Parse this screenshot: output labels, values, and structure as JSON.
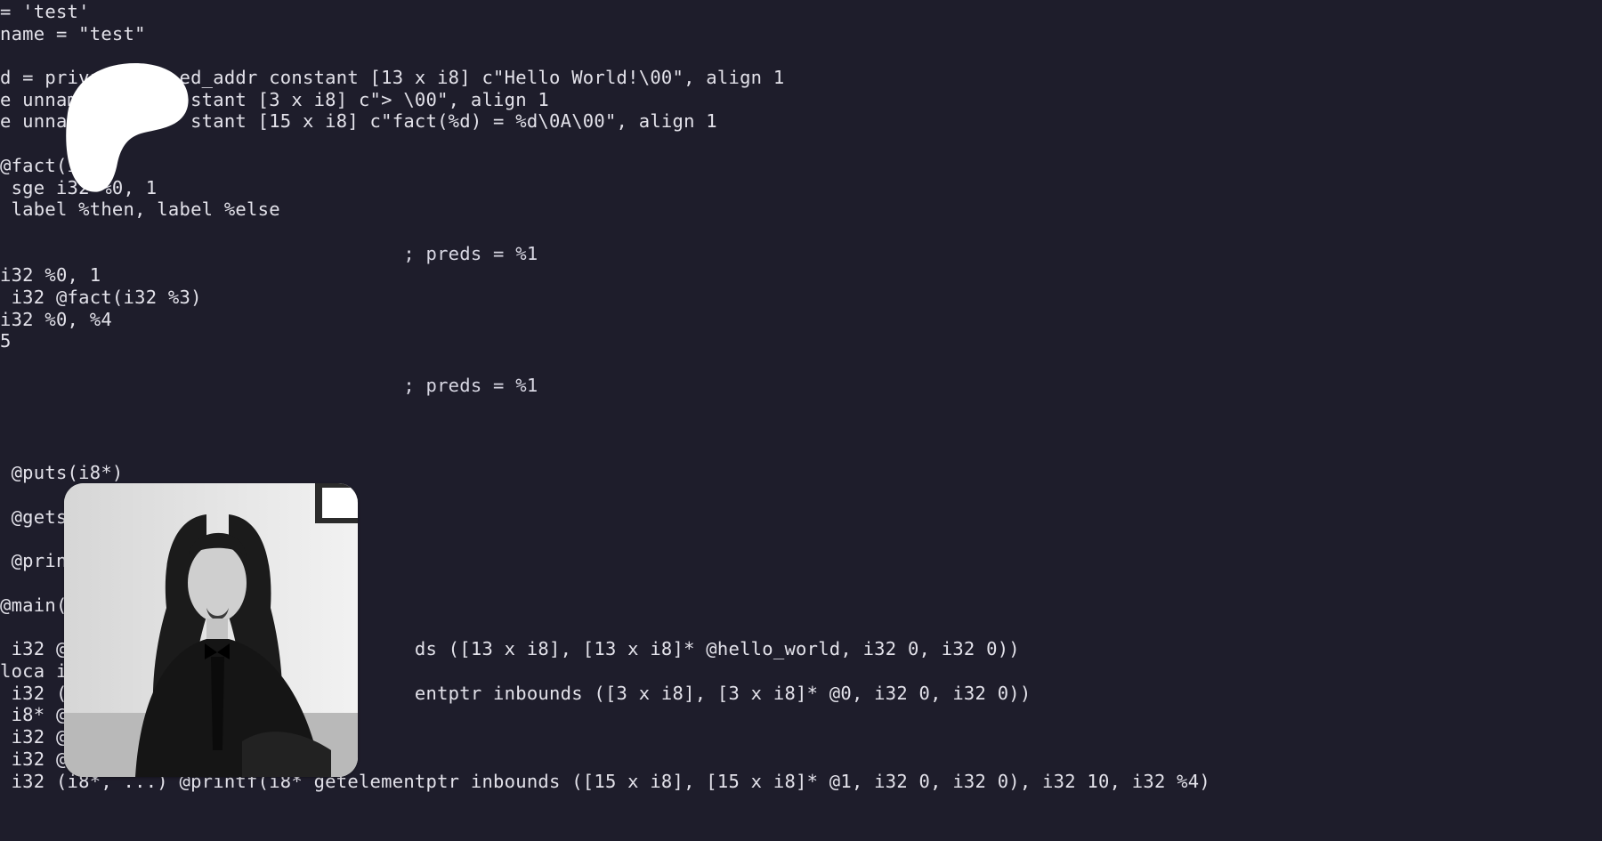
{
  "editor": {
    "background": "#1e1d2b",
    "text_color": "#e3e2ea",
    "lines": [
      "= 'test'",
      "name = \"test\"",
      "",
      "d = privat      ed_addr constant [13 x i8] c\"Hello World!\\00\", align 1",
      "e unnam          stant [3 x i8] c\"> \\00\", align 1",
      "e unnam          stant [15 x i8] c\"fact(%d) = %d\\0A\\00\", align 1",
      "",
      "@fact(i3",
      " sge i32 %0, 1",
      " label %then, label %else",
      "",
      "                                    ; preds = %1",
      "i32 %0, 1",
      " i32 @fact(i32 %3)",
      "i32 %0, %4",
      "5",
      "",
      "                                    ; preds = %1",
      "",
      "",
      "",
      " @puts(i8*)",
      "",
      " @gets(",
      "",
      " @print",
      "",
      "@main()",
      "",
      " i32 @p                              ds ([13 x i8], [13 x i8]* @hello_world, i32 0, i32 0))",
      "loca i8",
      " i32 (i                              entptr inbounds ([3 x i8], [3 x i8]* @0, i32 0, i32 0))",
      " i8* @g",
      " i32 @p",
      " i32 @f",
      " i32 (i8*, ...) @printf(i8* getelementptr inbounds ([15 x i8], [15 x i8]* @1, i32 0, i32 0), i32 10, i32 %4)"
    ]
  },
  "overlays": {
    "blob_color": "#ffffff",
    "avatar_icon": "person-photo"
  }
}
